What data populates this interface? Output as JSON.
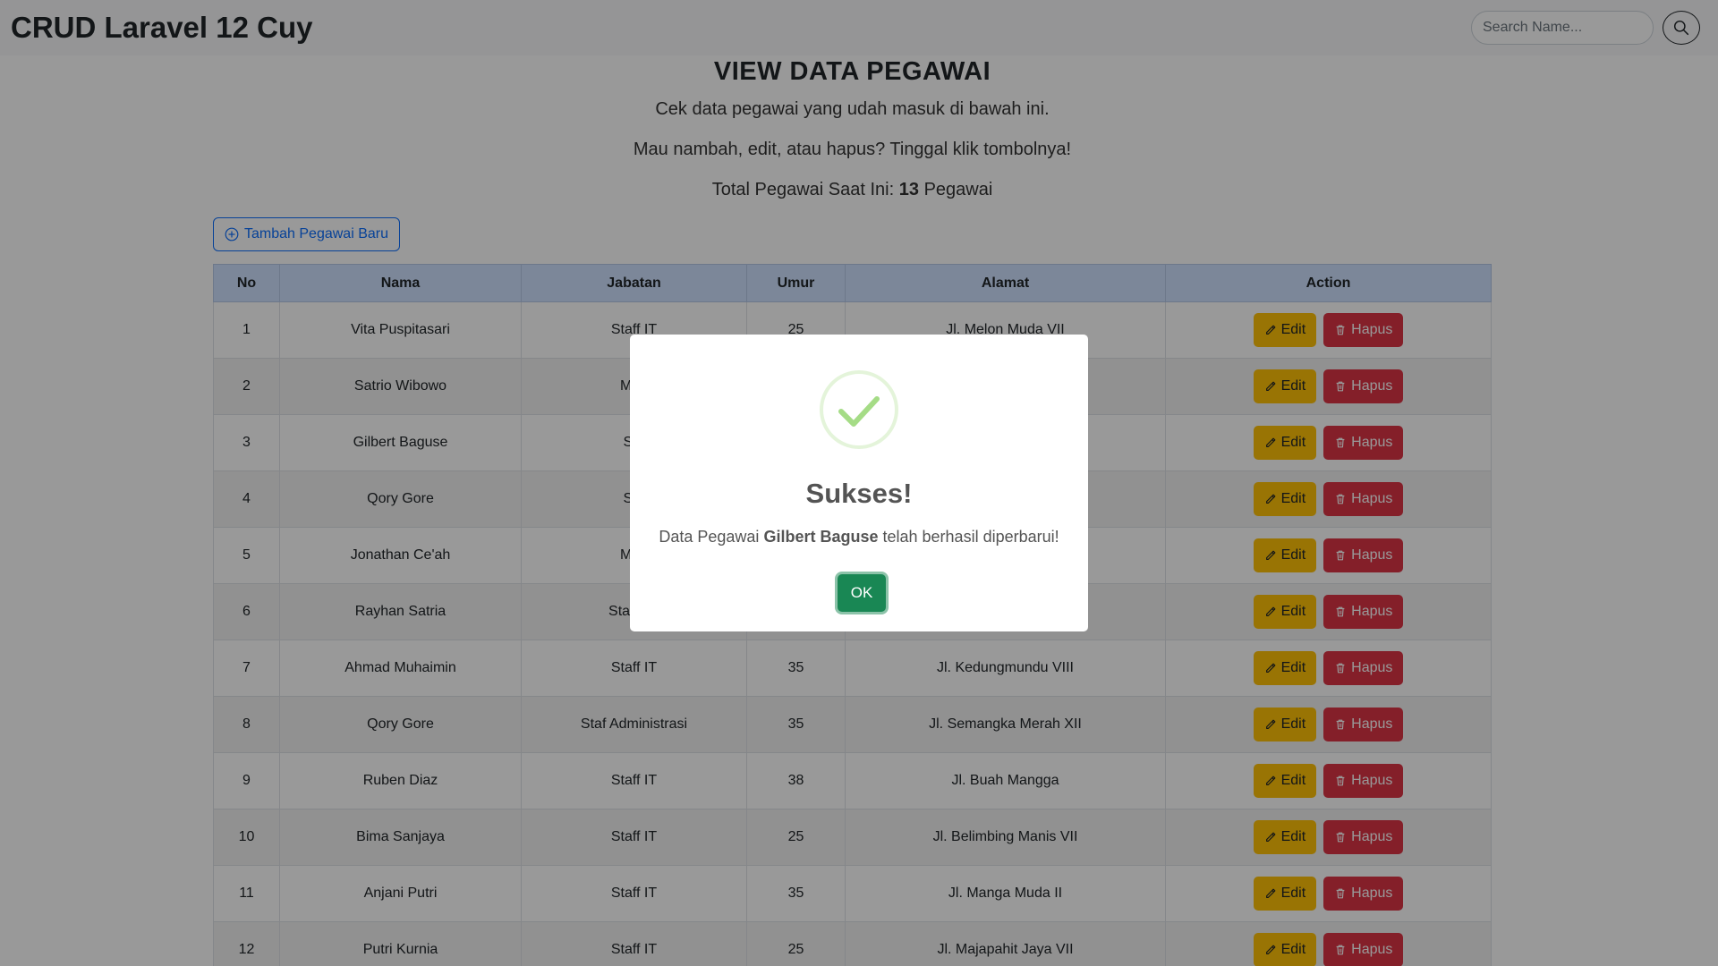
{
  "navbar": {
    "brand": "CRUD Laravel 12 Cuy",
    "search_placeholder": "Search Name..."
  },
  "header": {
    "title": "VIEW DATA PEGAWAI",
    "line1": "Cek data pegawai yang udah masuk di bawah ini.",
    "line2": "Mau nambah, edit, atau hapus? Tinggal klik tombolnya!",
    "total_prefix": "Total Pegawai Saat Ini:",
    "total_count": "13",
    "total_suffix": "Pegawai"
  },
  "add_button": "Tambah Pegawai Baru",
  "table": {
    "headers": [
      "No",
      "Nama",
      "Jabatan",
      "Umur",
      "Alamat",
      "Action"
    ],
    "edit_label": "Edit",
    "delete_label": "Hapus",
    "rows": [
      {
        "no": "1",
        "nama": "Vita Puspitasari",
        "jabatan": "Staff IT",
        "umur": "25",
        "alamat": "Jl. Melon Muda VII"
      },
      {
        "no": "2",
        "nama": "Satrio Wibowo",
        "jabatan": "Man",
        "umur": "",
        "alamat": ""
      },
      {
        "no": "3",
        "nama": "Gilbert Baguse",
        "jabatan": "Sta",
        "umur": "",
        "alamat": ""
      },
      {
        "no": "4",
        "nama": "Qory Gore",
        "jabatan": "Sta",
        "umur": "",
        "alamat": ""
      },
      {
        "no": "5",
        "nama": "Jonathan Ce'ah",
        "jabatan": "Man",
        "umur": "",
        "alamat": ""
      },
      {
        "no": "6",
        "nama": "Rayhan Satria",
        "jabatan": "Staf Adr",
        "umur": "",
        "alamat": ""
      },
      {
        "no": "7",
        "nama": "Ahmad Muhaimin",
        "jabatan": "Staff IT",
        "umur": "35",
        "alamat": "Jl. Kedungmundu VIII"
      },
      {
        "no": "8",
        "nama": "Qory Gore",
        "jabatan": "Staf Administrasi",
        "umur": "35",
        "alamat": "Jl. Semangka Merah XII"
      },
      {
        "no": "9",
        "nama": "Ruben Diaz",
        "jabatan": "Staff IT",
        "umur": "38",
        "alamat": "Jl. Buah Mangga"
      },
      {
        "no": "10",
        "nama": "Bima Sanjaya",
        "jabatan": "Staff IT",
        "umur": "25",
        "alamat": "Jl. Belimbing Manis VII"
      },
      {
        "no": "11",
        "nama": "Anjani Putri",
        "jabatan": "Staff IT",
        "umur": "35",
        "alamat": "Jl. Manga Muda II"
      },
      {
        "no": "12",
        "nama": "Putri Kurnia",
        "jabatan": "Staff IT",
        "umur": "25",
        "alamat": "Jl. Majapahit Jaya VII"
      }
    ]
  },
  "modal": {
    "title": "Sukses!",
    "text_prefix": "Data Pegawai",
    "text_name": "Gilbert Baguse",
    "text_suffix": "telah berhasil diperbarui!",
    "ok_label": "OK"
  },
  "colors": {
    "primary": "#0d6efd",
    "warning": "#ffc107",
    "danger": "#dc3545",
    "success": "#198754",
    "table_header": "#cfe2ff",
    "success_check": "#a5dc86"
  },
  "icons": {
    "search": "search-icon",
    "add": "plus-circle-icon",
    "edit": "pencil-icon",
    "delete": "trash-icon",
    "success": "checkmark-icon"
  }
}
